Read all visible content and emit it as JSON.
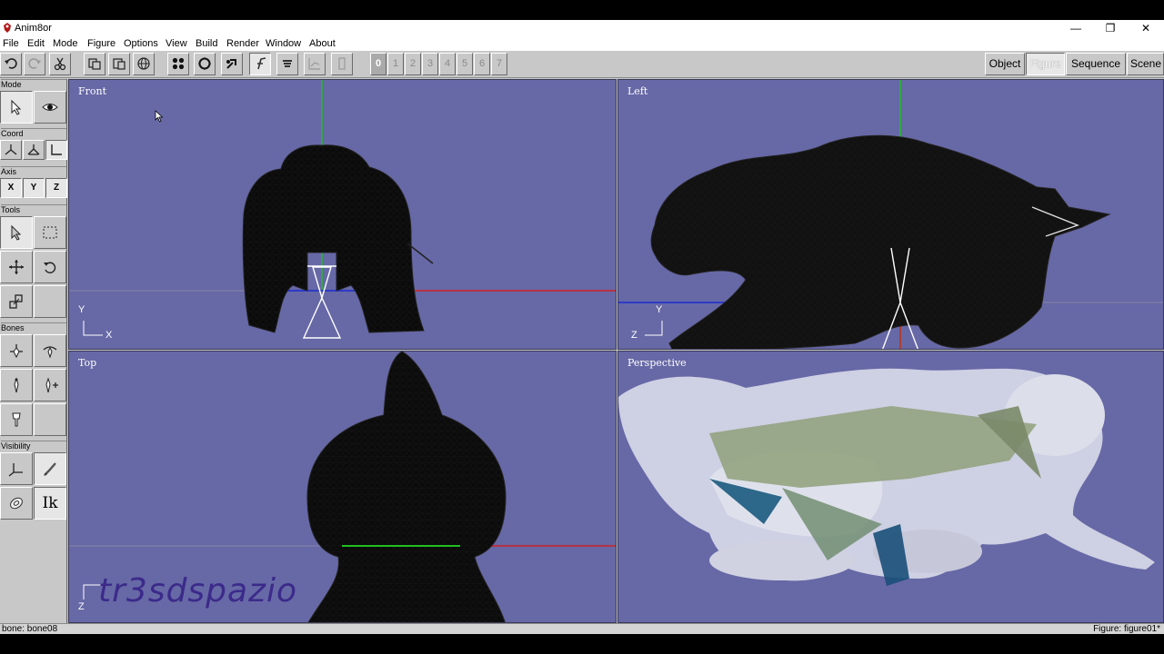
{
  "window": {
    "title": "Anim8or",
    "controls": {
      "minimize": "—",
      "maximize": "❐",
      "close": "✕"
    }
  },
  "menu": {
    "items": [
      "File",
      "Edit",
      "Mode",
      "Figure",
      "Options",
      "View",
      "Build",
      "Render",
      "Window",
      "About"
    ]
  },
  "toolbar": {
    "numbers": [
      "0",
      "1",
      "2",
      "3",
      "4",
      "5",
      "6",
      "7"
    ],
    "active_number": "0",
    "modes": [
      "Object",
      "Figure",
      "Sequence",
      "Scene"
    ],
    "active_mode": "Figure"
  },
  "left_panel": {
    "sections": {
      "mode": "Mode",
      "coord": "Coord",
      "axis": "Axis",
      "tools": "Tools",
      "bones": "Bones",
      "visibility": "Visibility"
    },
    "axis_buttons": [
      "X",
      "Y",
      "Z"
    ],
    "ik_label": "Ik"
  },
  "viewports": {
    "front": {
      "label": "Front",
      "axis_v": "Y",
      "axis_h": "X"
    },
    "left": {
      "label": "Left",
      "axis_v": "Y",
      "axis_h": "Z"
    },
    "top": {
      "label": "Top",
      "axis_v": "Z"
    },
    "perspective": {
      "label": "Perspective"
    }
  },
  "status": {
    "left": "bone: bone08",
    "right": "Figure: figure01*"
  },
  "watermark": "tr3sdspazio",
  "colors": {
    "viewport_bg": "#6768a6",
    "x_axis": "#d02020",
    "y_axis": "#20c020",
    "z_axis": "#1a2ad0",
    "mesh": "#111111"
  }
}
